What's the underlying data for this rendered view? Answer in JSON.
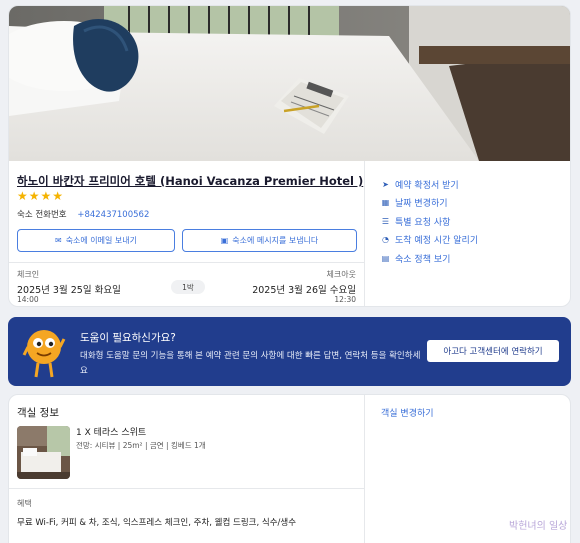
{
  "hotel": {
    "name": "하노이 바칸자 프리미어 호텔 (Hanoi Vacanza Premier Hotel )",
    "stars": "★★★★",
    "phone_label": "숙소 전화번호",
    "phone_number": "+842437100562",
    "email_button": "숙소에 이메일 보내기",
    "message_button": "숙소에 메시지를 보냅니다",
    "checkin": {
      "label": "체크인",
      "date": "2025년 3월 25일 화요일",
      "time": "14:00"
    },
    "nights": "1박",
    "checkout": {
      "label": "체크아웃",
      "date": "2025년 3월 26일 수요일",
      "time": "12:30"
    }
  },
  "actions": [
    {
      "icon": "send-icon",
      "glyph": "➤",
      "label": "예약 확정서 받기"
    },
    {
      "icon": "calendar-icon",
      "glyph": "▦",
      "label": "날짜 변경하기"
    },
    {
      "icon": "list-icon",
      "glyph": "☰",
      "label": "특별 요청 사항"
    },
    {
      "icon": "clock-icon",
      "glyph": "◔",
      "label": "도착 예정 시간 알리기"
    },
    {
      "icon": "document-icon",
      "glyph": "▤",
      "label": "숙소 정책 보기"
    }
  ],
  "help": {
    "title": "도움이 필요하신가요?",
    "description": "대화형 도움말 문의 기능을 통해 본 예약 관련 문의 사항에 대한 빠른 답변, 연락처 등을 확인하세요",
    "button": "아고다 고객센터에 연락하기"
  },
  "room": {
    "section_title": "객실 정보",
    "name": "1 X 테라스 스위트",
    "details": "전망: 시티뷰 | 25m² | 금연 | 킹베드 1개",
    "benefits_label": "혜택",
    "benefits": "무료 Wi-Fi, 커피 & 차, 조식, 익스프레스 체크인, 주차, 웰컴 드링크, 식수/생수",
    "change_room": "객실 변경하기"
  },
  "watermark": "박헌녀의 일상",
  "colors": {
    "accent": "#3a6fd8",
    "banner": "#213d8d",
    "star": "#f5b301"
  }
}
